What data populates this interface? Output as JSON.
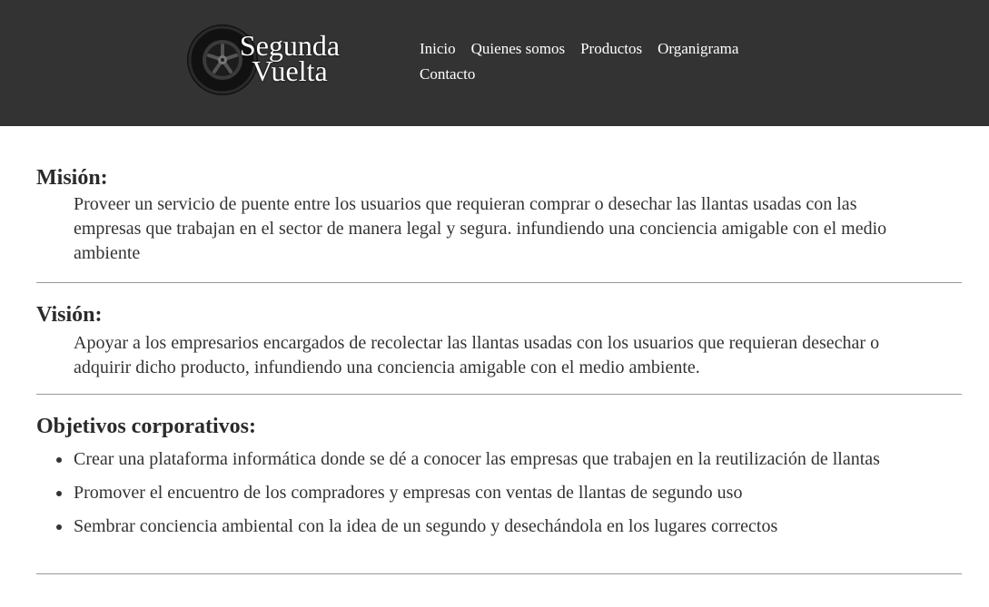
{
  "header": {
    "logo_line1": "Segunda",
    "logo_line2": "Vuelta",
    "background_color": "#333333"
  },
  "nav": {
    "items": [
      "Inicio",
      "Quienes somos",
      "Productos",
      "Organigrama",
      "Contacto"
    ]
  },
  "mision": {
    "heading": "Misión:",
    "text": "Proveer un servicio de puente entre los usuarios que requieran comprar o desechar las llantas usadas con las empresas que trabajan en el sector de manera legal y segura. infundiendo una conciencia amigable con el medio ambiente"
  },
  "vision": {
    "heading": "Visión:",
    "text": "Apoyar a los empresarios encargados de recolectar las llantas usadas con los usuarios que requieran desechar o adquirir dicho producto, infundiendo una conciencia amigable con el medio ambiente."
  },
  "objetivos": {
    "heading": "Objetivos corporativos:",
    "items": [
      "Crear una plataforma informática donde se dé a conocer las empresas que trabajen en la reutilización de llantas",
      "Promover el encuentro de los compradores y empresas con ventas de llantas de segundo uso",
      "Sembrar conciencia ambiental con la idea de un segundo y desechándola en los lugares correctos"
    ]
  }
}
